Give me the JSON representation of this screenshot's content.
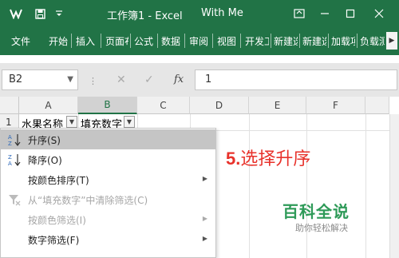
{
  "window": {
    "title": "工作簿1 - Excel",
    "user": "With Me",
    "icons": [
      "excel-logo-icon",
      "save-icon",
      "quick-access-dropdown-icon",
      "minimize-icon",
      "restore-icon",
      "close-icon"
    ]
  },
  "ribbon": {
    "tabs": [
      "文件",
      "开始",
      "插入",
      "页面布局",
      "公式",
      "数据",
      "审阅",
      "视图",
      "开发工具",
      "新建选项卡",
      "新建选项卡",
      "加载项",
      "负载测试"
    ],
    "scroll_icon": "ribbon-scroll-right-icon"
  },
  "formula_bar": {
    "name_box": "B2",
    "fx": "fx",
    "value": "1"
  },
  "grid": {
    "columns": [
      "A",
      "B",
      "C",
      "D",
      "E",
      "F"
    ],
    "selected_column": "B",
    "rows": [
      "1"
    ],
    "cells": {
      "a1": "水果名称",
      "b1": "填充数字"
    }
  },
  "filter_menu": {
    "items": [
      {
        "label": "升序(S)",
        "icon": "sort-ascending-icon",
        "enabled": true,
        "highlighted": true,
        "submenu": false
      },
      {
        "label": "降序(O)",
        "icon": "sort-descending-icon",
        "enabled": true,
        "highlighted": false,
        "submenu": false
      },
      {
        "label": "按颜色排序(T)",
        "icon": "",
        "enabled": true,
        "highlighted": false,
        "submenu": true
      },
      {
        "label": "从“填充数字”中清除筛选(C)",
        "icon": "clear-filter-icon",
        "enabled": false,
        "highlighted": false,
        "submenu": false
      },
      {
        "label": "按颜色筛选(I)",
        "icon": "",
        "enabled": false,
        "highlighted": false,
        "submenu": true
      },
      {
        "label": "数字筛选(F)",
        "icon": "",
        "enabled": true,
        "highlighted": false,
        "submenu": true
      }
    ]
  },
  "annotation": {
    "step": "5.",
    "text": "选择升序",
    "color": "#e8322b"
  },
  "watermark": {
    "title": "百科全说",
    "subtitle": "助你轻松解决"
  },
  "colors": {
    "excel_green": "#217346",
    "menu_highlight": "#c5c5c5",
    "annotation_red": "#e8322b",
    "watermark_green": "#2e9a58"
  }
}
